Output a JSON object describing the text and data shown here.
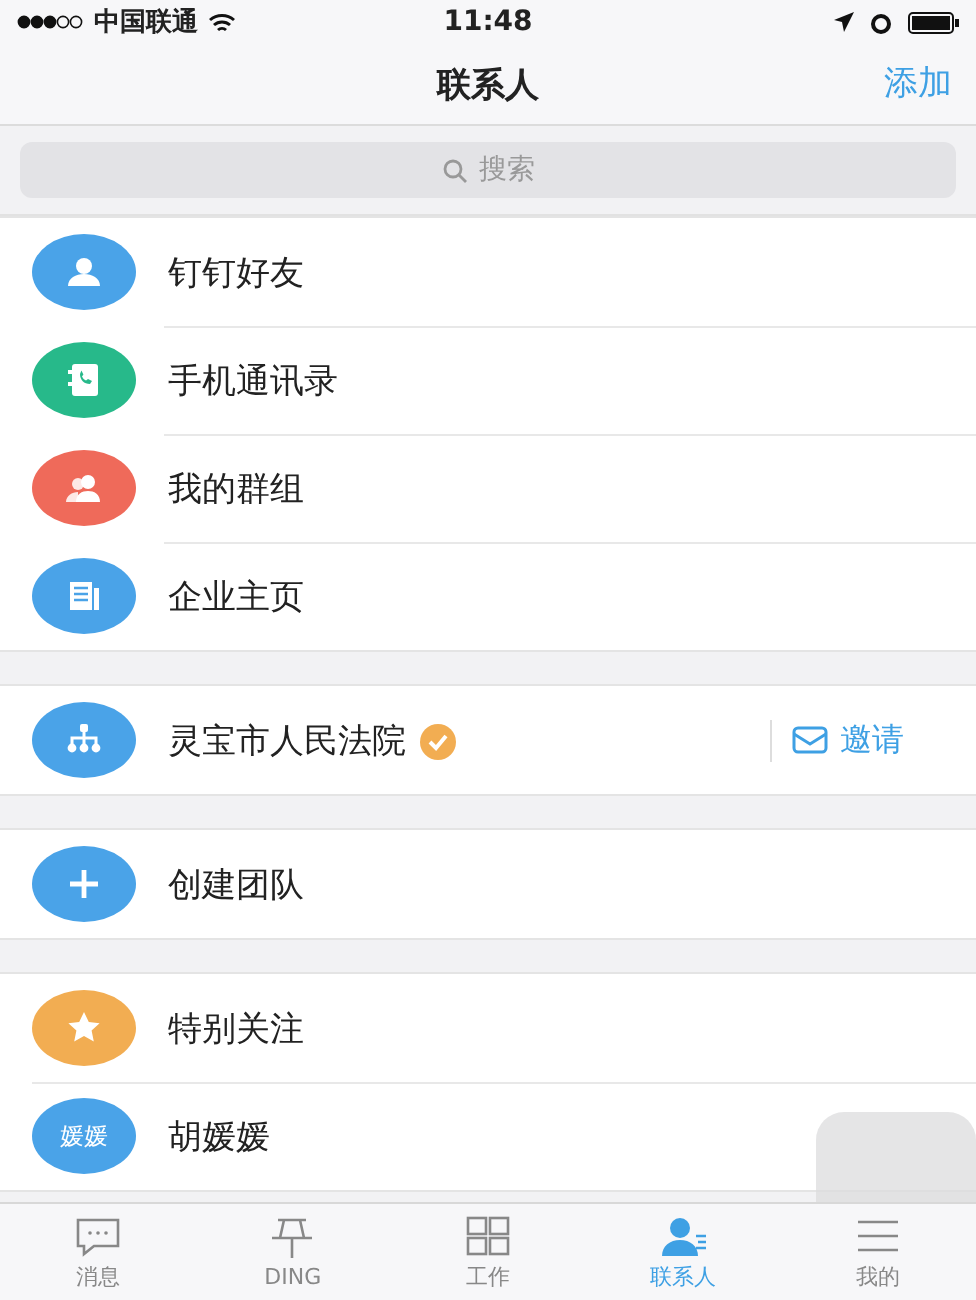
{
  "status_bar": {
    "carrier": "中国联通",
    "time": "11:48"
  },
  "nav": {
    "title": "联系人",
    "action": "添加"
  },
  "search": {
    "placeholder": "搜索"
  },
  "sections": [
    {
      "items": [
        {
          "kind": "person",
          "label": "钉钉好友",
          "color": "#4aa3e8"
        },
        {
          "kind": "phonebook",
          "label": "手机通讯录",
          "color": "#27b98a"
        },
        {
          "kind": "group",
          "label": "我的群组",
          "color": "#ef6a5a"
        },
        {
          "kind": "company",
          "label": "企业主页",
          "color": "#4aa3e8"
        }
      ]
    },
    {
      "items": [
        {
          "kind": "org",
          "label": "灵宝市人民法院",
          "color": "#4aa3e8",
          "verified": true,
          "action": "邀请"
        }
      ]
    },
    {
      "items": [
        {
          "kind": "plus",
          "label": "创建团队",
          "color": "#4aa3e8"
        }
      ]
    },
    {
      "items": [
        {
          "kind": "star",
          "label": "特别关注",
          "color": "#f2ad52"
        },
        {
          "kind": "avatar",
          "avatar_text": "媛媛",
          "label": "胡媛媛",
          "color": "#4aa3e8"
        }
      ]
    }
  ],
  "tabs": [
    {
      "kind": "chat",
      "label": "消息",
      "selected": false
    },
    {
      "kind": "pin",
      "label": "DING",
      "selected": false
    },
    {
      "kind": "grid",
      "label": "工作",
      "selected": false
    },
    {
      "kind": "contacts",
      "label": "联系人",
      "selected": true
    },
    {
      "kind": "menu",
      "label": "我的",
      "selected": false
    }
  ]
}
